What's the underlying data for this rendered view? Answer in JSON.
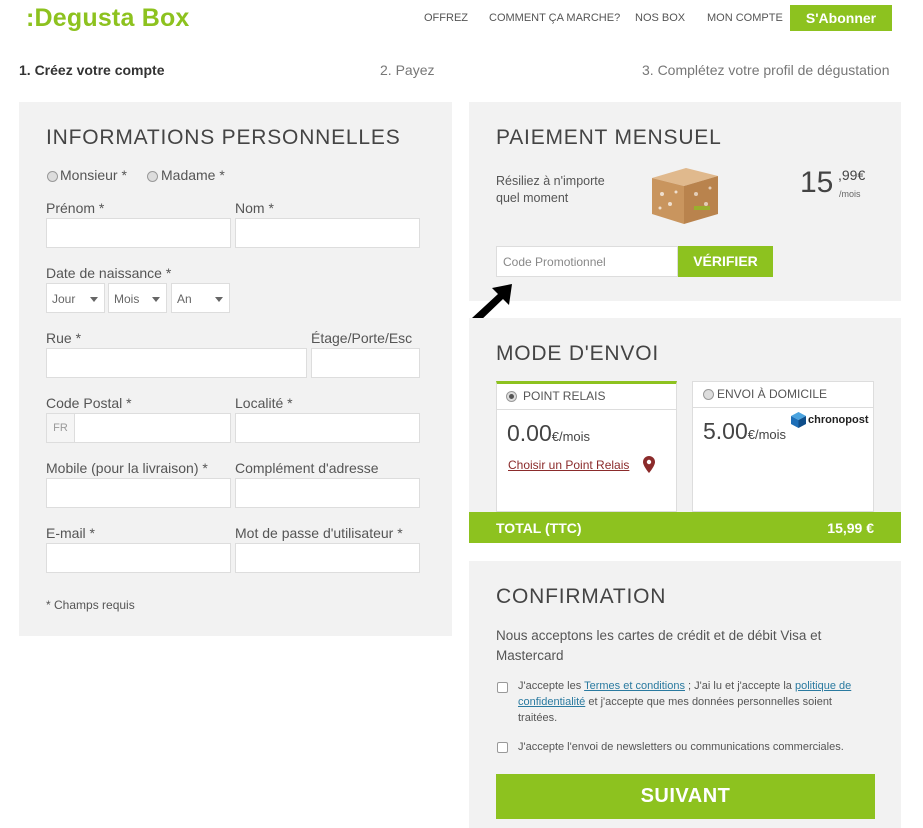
{
  "header": {
    "logo": ":Degusta Box",
    "nav": [
      "OFFREZ",
      "COMMENT ÇA MARCHE?",
      "NOS BOX",
      "MON COMPTE"
    ],
    "subscribe": "S'Abonner"
  },
  "steps": [
    "1. Créez votre compte",
    "2. Payez",
    "3. Complétez votre profil de dégustation"
  ],
  "personal": {
    "title": "INFORMATIONS PERSONNELLES",
    "salutation": [
      "Monsieur *",
      "Madame *"
    ],
    "prenom": "Prénom *",
    "nom": "Nom *",
    "dob_label": "Date de naissance *",
    "dob_selects": [
      "Jour",
      "Mois",
      "An"
    ],
    "rue": "Rue *",
    "etage": "Étage/Porte/Esc",
    "code_postal": "Code Postal *",
    "country_prefix": "FR",
    "localite": "Localité *",
    "mobile": "Mobile (pour la livraison) *",
    "complement": "Complément d'adresse",
    "email": "E-mail *",
    "password": "Mot de passe d'utilisateur *",
    "required_note": "* Champs requis"
  },
  "payment": {
    "title": "PAIEMENT MENSUEL",
    "cancel_text": "Résiliez à n'importe quel moment",
    "price_main": "15",
    "price_cents": ",99€",
    "price_unit": "/mois",
    "promo_placeholder": "Code Promotionnel",
    "verify": "VÉRIFIER"
  },
  "shipping": {
    "title": "MODE D'ENVOI",
    "option1_label": "POINT RELAIS",
    "option1_price": "0.00",
    "option1_unit": "€/mois",
    "option1_link": "Choisir un Point Relais",
    "option2_label": "ENVOI À DOMICILE",
    "option2_price": "5.00",
    "option2_unit": "€/mois",
    "carrier": "chronopost",
    "total_label": "TOTAL (TTC)",
    "total_value": "15,99 €"
  },
  "confirmation": {
    "title": "CONFIRMATION",
    "cards_text": "Nous acceptons les cartes de crédit et de débit Visa et Mastercard",
    "terms_1": "J'accepte les ",
    "terms_link1": "Termes et conditions",
    "terms_2": " ; J'ai lu et j'accepte la ",
    "terms_link2": "politique de confidentialité",
    "terms_3": " et j'accepte que mes données personnelles soient traitées.",
    "newsletter": "J'accepte l'envoi de newsletters ou communications commerciales.",
    "next": "SUIVANT"
  },
  "colors": {
    "accent": "#8dc21f",
    "panel": "#f2f2f2",
    "link": "#2a7aa0",
    "pin": "#8b2b2b"
  }
}
